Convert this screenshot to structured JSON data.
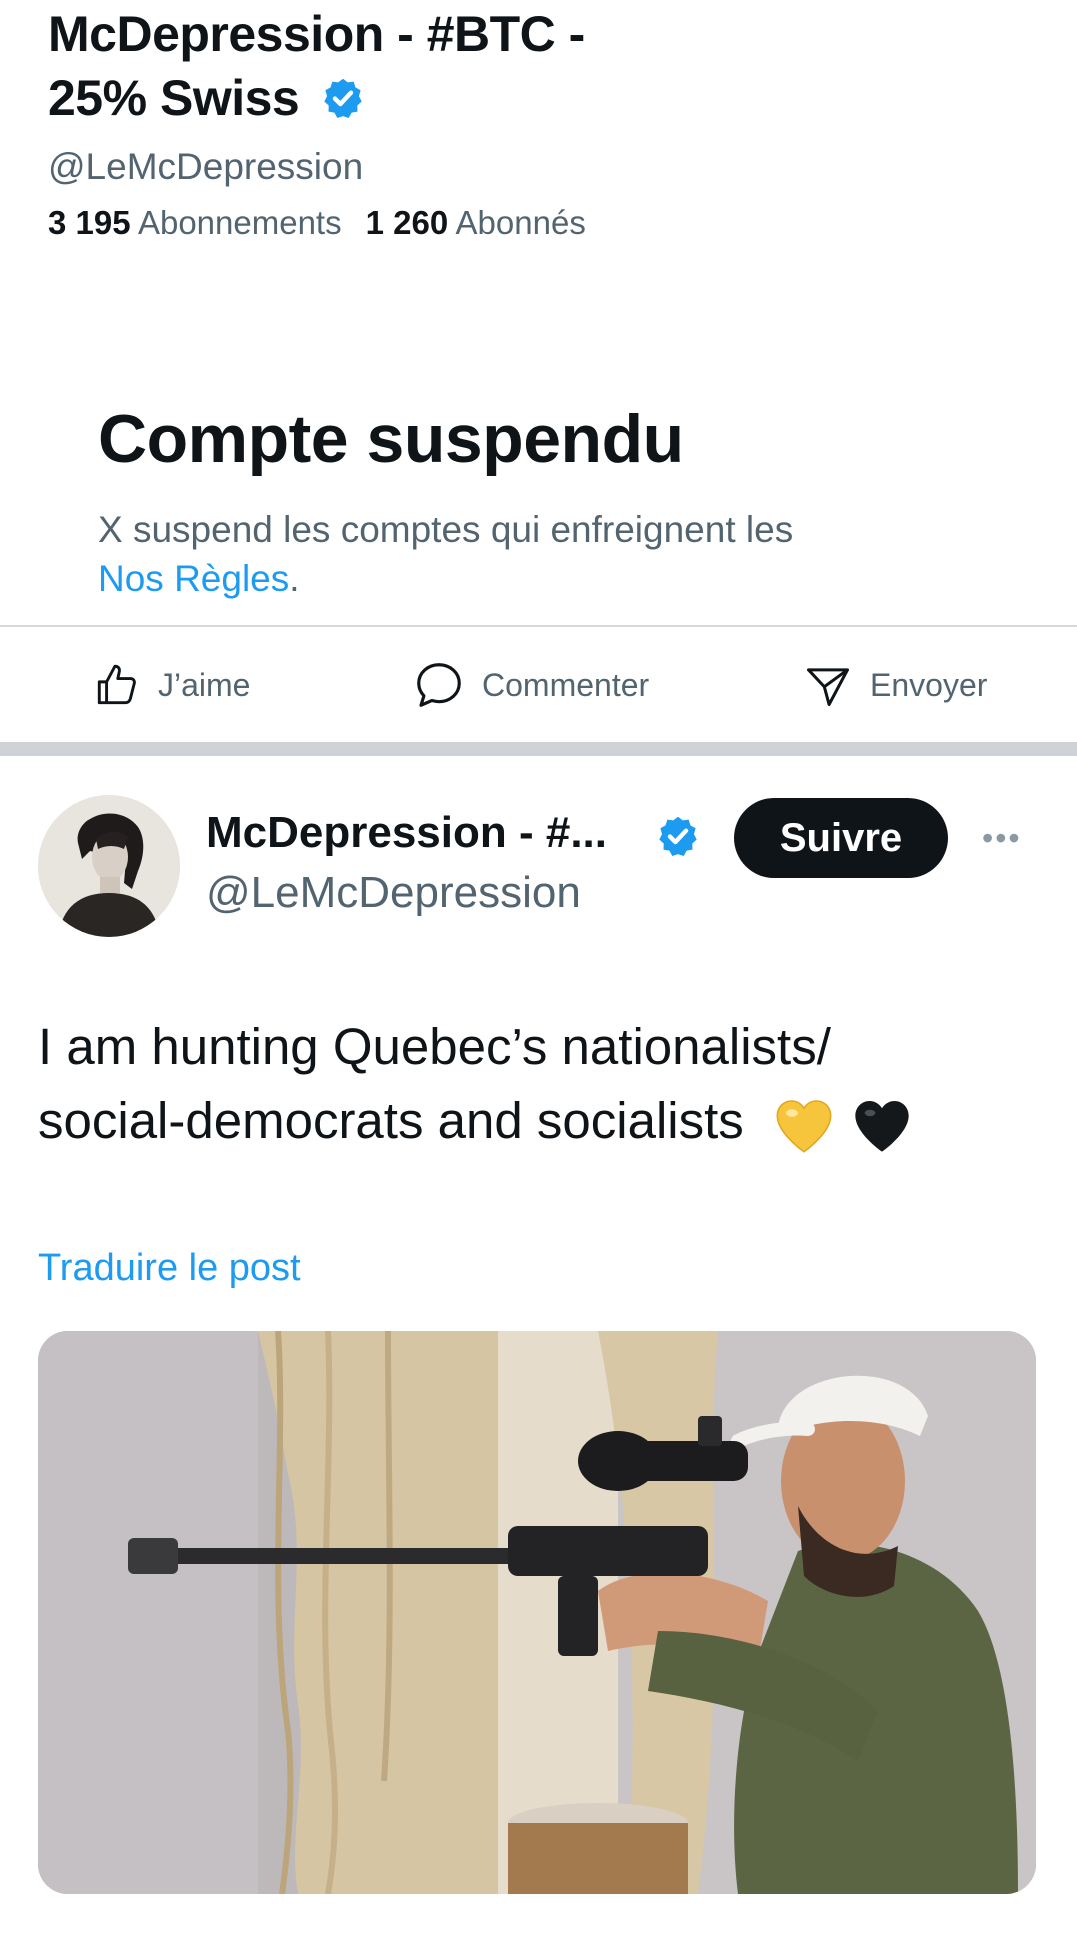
{
  "profile": {
    "display_name_line1": "McDepression - #BTC -",
    "display_name_line2": "25% Swiss",
    "verified_icon": "verified-badge-icon",
    "handle": "@LeMcDepression",
    "following_count": "3 195",
    "following_label": "Abonnements",
    "followers_count": "1 260",
    "followers_label": "Abonnés"
  },
  "suspension": {
    "title": "Compte suspendu",
    "text": "X suspend les comptes qui enfreignent les",
    "link": "Nos Règles",
    "period": "."
  },
  "actions": {
    "like": "J’aime",
    "comment": "Commenter",
    "send": "Envoyer"
  },
  "post": {
    "author_name": "McDepression - #...",
    "author_handle": "@LeMcDepression",
    "follow_label": "Suivre",
    "more_label": "•••",
    "text_line1": "I am hunting Quebec’s nationalists/",
    "text_line2": "social-democrats and socialists",
    "emojis": [
      "yellow-heart-icon",
      "black-heart-icon"
    ],
    "translate_label": "Traduire le post"
  },
  "colors": {
    "text": "#0f1419",
    "secondary": "#536471",
    "accent": "#1d9bf0",
    "follow_button": "#0f1419",
    "separator": "#cfd3d8"
  }
}
